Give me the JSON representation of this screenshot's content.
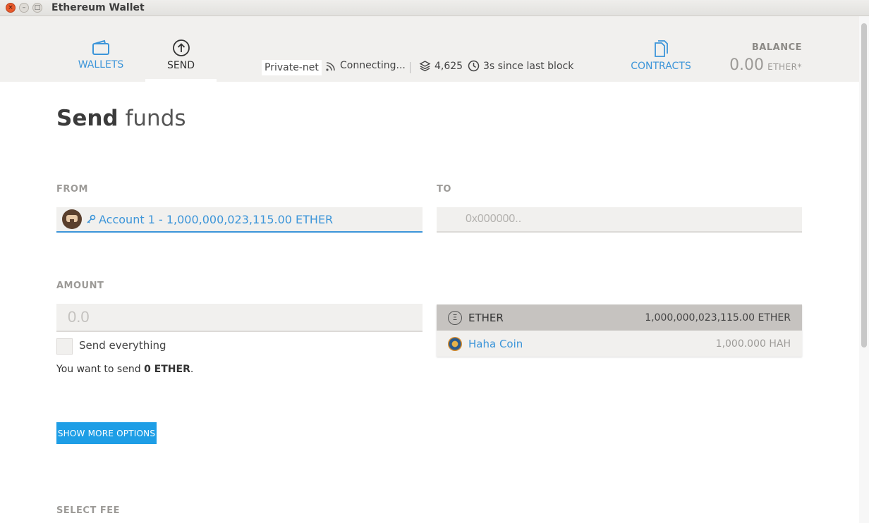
{
  "window": {
    "title": "Ethereum Wallet"
  },
  "nav": {
    "wallets": "WALLETS",
    "send": "SEND",
    "contracts": "CONTRACTS"
  },
  "status": {
    "network": "Private-net",
    "connection": "Connecting...",
    "blocks": "4,625",
    "last_block": "3s since last block"
  },
  "balance": {
    "label": "BALANCE",
    "value": "0.00",
    "unit": "ETHER*"
  },
  "page": {
    "title_bold": "Send",
    "title_light": "funds"
  },
  "form": {
    "from_label": "FROM",
    "from_account": "Account 1 - 1,000,000,023,115.00 ETHER",
    "to_label": "TO",
    "to_placeholder": "0x000000..",
    "amount_label": "AMOUNT",
    "amount_placeholder": "0.0",
    "send_everything": "Send everything",
    "summary_prefix": "You want to send",
    "summary_amount": "0 ETHER",
    "summary_suffix": ".",
    "more_options": "SHOW MORE OPTIONS",
    "select_fee": "SELECT FEE"
  },
  "tokens": [
    {
      "icon": "ether-icon",
      "name": "ETHER",
      "amount": "1,000,000,023,115.00 ETHER",
      "selected": true
    },
    {
      "icon": "haha-coin-icon",
      "name": "Haha Coin",
      "amount": "1,000.000 HAH",
      "selected": false
    }
  ],
  "colors": {
    "accent": "#3c95d9",
    "button": "#1e9ee6",
    "header_bg": "#f1f0ee"
  }
}
